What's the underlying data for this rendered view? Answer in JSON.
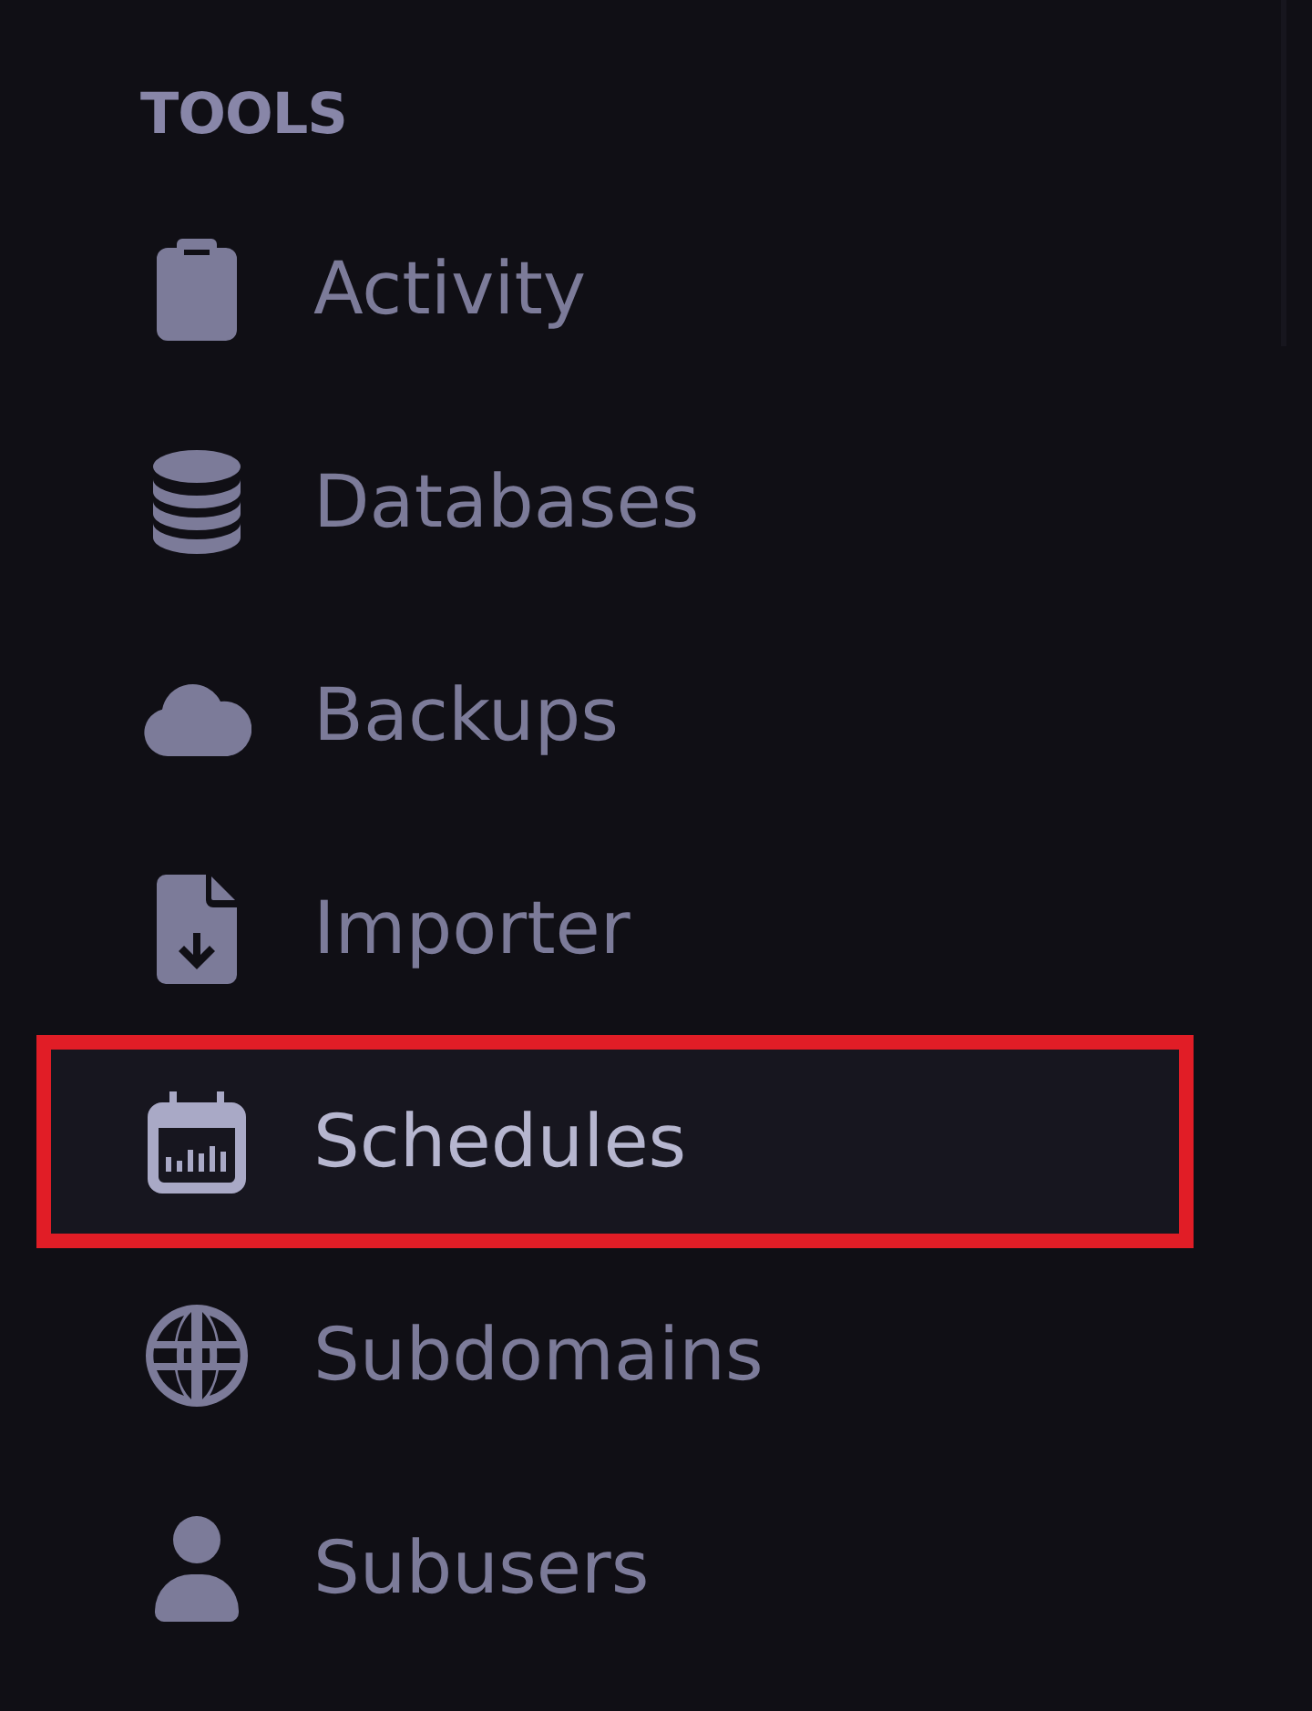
{
  "sidebar": {
    "section_title": "TOOLS",
    "items": [
      {
        "label": "Activity",
        "selected": false,
        "outlined": false
      },
      {
        "label": "Databases",
        "selected": false,
        "outlined": false
      },
      {
        "label": "Backups",
        "selected": false,
        "outlined": false
      },
      {
        "label": "Importer",
        "selected": false,
        "outlined": false
      },
      {
        "label": "Schedules",
        "selected": true,
        "outlined": true
      },
      {
        "label": "Subdomains",
        "selected": false,
        "outlined": false
      },
      {
        "label": "Subusers",
        "selected": false,
        "outlined": false
      }
    ]
  }
}
